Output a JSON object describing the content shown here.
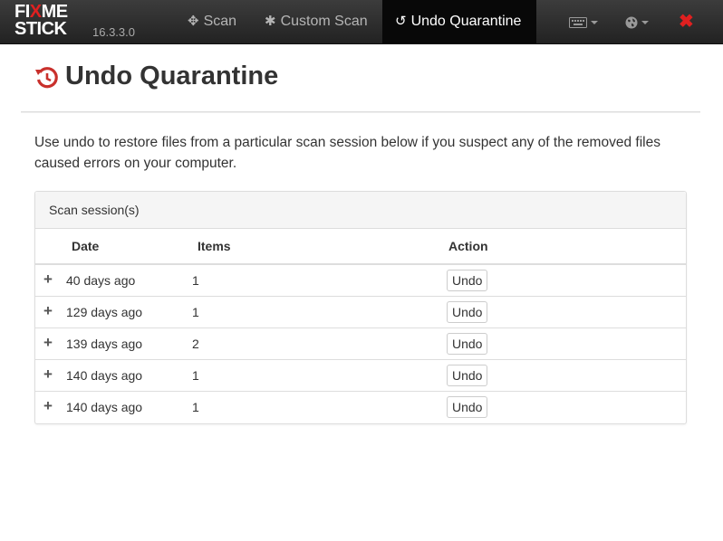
{
  "brand": {
    "logo_line1_a": "FI",
    "logo_line1_b": "X",
    "logo_line1_c": "ME",
    "logo_line2": "STICK",
    "version": "16.3.3.0"
  },
  "nav": {
    "scan": "Scan",
    "custom_scan": "Custom Scan",
    "undo_quarantine": "Undo Quarantine",
    "close_glyph": "✖"
  },
  "page": {
    "title": "Undo Quarantine",
    "intro": "Use undo to restore files from a particular scan session below if you suspect any of the removed files caused errors on your computer."
  },
  "panel": {
    "heading": "Scan session(s)",
    "columns": {
      "date": "Date",
      "items": "Items",
      "action": "Action"
    },
    "rows": [
      {
        "date": "40 days ago",
        "items": "1",
        "action": "Undo"
      },
      {
        "date": "129 days ago",
        "items": "1",
        "action": "Undo"
      },
      {
        "date": "139 days ago",
        "items": "2",
        "action": "Undo"
      },
      {
        "date": "140 days ago",
        "items": "1",
        "action": "Undo"
      },
      {
        "date": "140 days ago",
        "items": "1",
        "action": "Undo"
      }
    ]
  },
  "icons": {
    "scan": "crosshair-icon",
    "custom_scan": "gear-icon",
    "undo": "undo-icon",
    "keyboard": "keyboard-icon",
    "globe": "globe-icon",
    "close": "close-icon",
    "expand": "plus-icon"
  },
  "colors": {
    "brand_red": "#e02020",
    "navbar": "#2b2b2b",
    "active_tab": "#080808"
  }
}
